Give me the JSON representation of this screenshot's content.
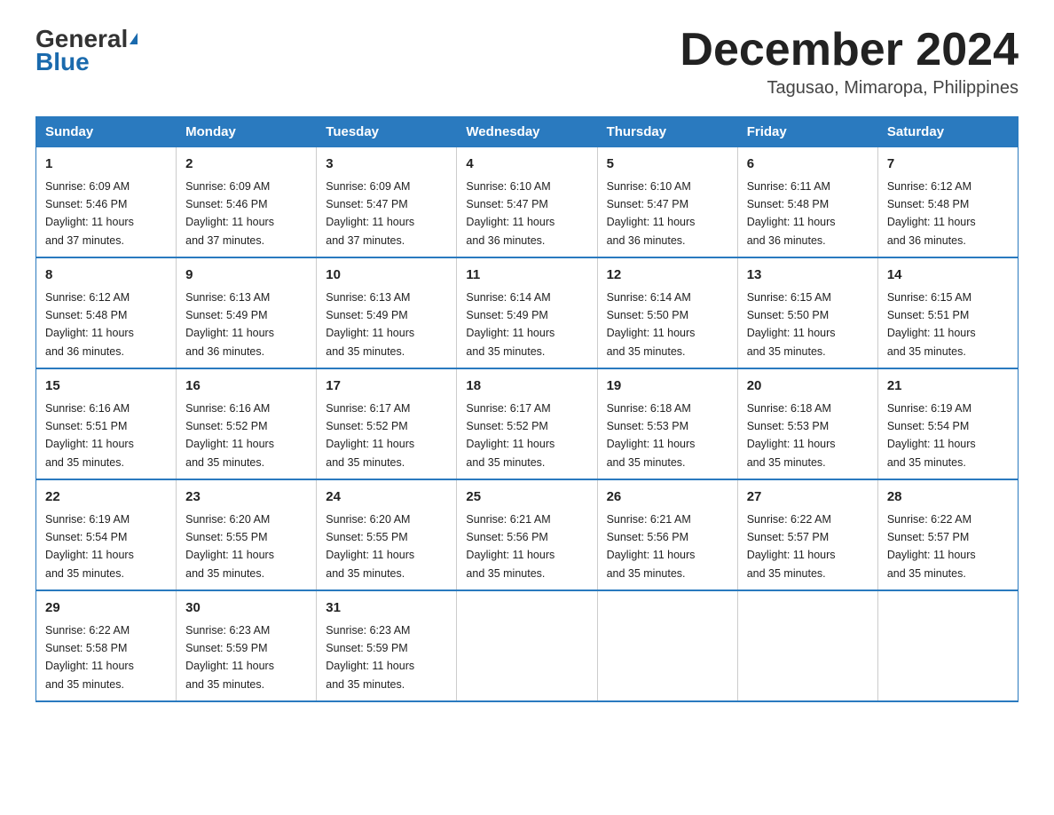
{
  "header": {
    "logo_general": "General",
    "logo_blue": "Blue",
    "month_title": "December 2024",
    "location": "Tagusao, Mimaropa, Philippines"
  },
  "days_of_week": [
    "Sunday",
    "Monday",
    "Tuesday",
    "Wednesday",
    "Thursday",
    "Friday",
    "Saturday"
  ],
  "weeks": [
    [
      {
        "day": "1",
        "sunrise": "6:09 AM",
        "sunset": "5:46 PM",
        "daylight": "11 hours and 37 minutes."
      },
      {
        "day": "2",
        "sunrise": "6:09 AM",
        "sunset": "5:46 PM",
        "daylight": "11 hours and 37 minutes."
      },
      {
        "day": "3",
        "sunrise": "6:09 AM",
        "sunset": "5:47 PM",
        "daylight": "11 hours and 37 minutes."
      },
      {
        "day": "4",
        "sunrise": "6:10 AM",
        "sunset": "5:47 PM",
        "daylight": "11 hours and 36 minutes."
      },
      {
        "day": "5",
        "sunrise": "6:10 AM",
        "sunset": "5:47 PM",
        "daylight": "11 hours and 36 minutes."
      },
      {
        "day": "6",
        "sunrise": "6:11 AM",
        "sunset": "5:48 PM",
        "daylight": "11 hours and 36 minutes."
      },
      {
        "day": "7",
        "sunrise": "6:12 AM",
        "sunset": "5:48 PM",
        "daylight": "11 hours and 36 minutes."
      }
    ],
    [
      {
        "day": "8",
        "sunrise": "6:12 AM",
        "sunset": "5:48 PM",
        "daylight": "11 hours and 36 minutes."
      },
      {
        "day": "9",
        "sunrise": "6:13 AM",
        "sunset": "5:49 PM",
        "daylight": "11 hours and 36 minutes."
      },
      {
        "day": "10",
        "sunrise": "6:13 AM",
        "sunset": "5:49 PM",
        "daylight": "11 hours and 35 minutes."
      },
      {
        "day": "11",
        "sunrise": "6:14 AM",
        "sunset": "5:49 PM",
        "daylight": "11 hours and 35 minutes."
      },
      {
        "day": "12",
        "sunrise": "6:14 AM",
        "sunset": "5:50 PM",
        "daylight": "11 hours and 35 minutes."
      },
      {
        "day": "13",
        "sunrise": "6:15 AM",
        "sunset": "5:50 PM",
        "daylight": "11 hours and 35 minutes."
      },
      {
        "day": "14",
        "sunrise": "6:15 AM",
        "sunset": "5:51 PM",
        "daylight": "11 hours and 35 minutes."
      }
    ],
    [
      {
        "day": "15",
        "sunrise": "6:16 AM",
        "sunset": "5:51 PM",
        "daylight": "11 hours and 35 minutes."
      },
      {
        "day": "16",
        "sunrise": "6:16 AM",
        "sunset": "5:52 PM",
        "daylight": "11 hours and 35 minutes."
      },
      {
        "day": "17",
        "sunrise": "6:17 AM",
        "sunset": "5:52 PM",
        "daylight": "11 hours and 35 minutes."
      },
      {
        "day": "18",
        "sunrise": "6:17 AM",
        "sunset": "5:52 PM",
        "daylight": "11 hours and 35 minutes."
      },
      {
        "day": "19",
        "sunrise": "6:18 AM",
        "sunset": "5:53 PM",
        "daylight": "11 hours and 35 minutes."
      },
      {
        "day": "20",
        "sunrise": "6:18 AM",
        "sunset": "5:53 PM",
        "daylight": "11 hours and 35 minutes."
      },
      {
        "day": "21",
        "sunrise": "6:19 AM",
        "sunset": "5:54 PM",
        "daylight": "11 hours and 35 minutes."
      }
    ],
    [
      {
        "day": "22",
        "sunrise": "6:19 AM",
        "sunset": "5:54 PM",
        "daylight": "11 hours and 35 minutes."
      },
      {
        "day": "23",
        "sunrise": "6:20 AM",
        "sunset": "5:55 PM",
        "daylight": "11 hours and 35 minutes."
      },
      {
        "day": "24",
        "sunrise": "6:20 AM",
        "sunset": "5:55 PM",
        "daylight": "11 hours and 35 minutes."
      },
      {
        "day": "25",
        "sunrise": "6:21 AM",
        "sunset": "5:56 PM",
        "daylight": "11 hours and 35 minutes."
      },
      {
        "day": "26",
        "sunrise": "6:21 AM",
        "sunset": "5:56 PM",
        "daylight": "11 hours and 35 minutes."
      },
      {
        "day": "27",
        "sunrise": "6:22 AM",
        "sunset": "5:57 PM",
        "daylight": "11 hours and 35 minutes."
      },
      {
        "day": "28",
        "sunrise": "6:22 AM",
        "sunset": "5:57 PM",
        "daylight": "11 hours and 35 minutes."
      }
    ],
    [
      {
        "day": "29",
        "sunrise": "6:22 AM",
        "sunset": "5:58 PM",
        "daylight": "11 hours and 35 minutes."
      },
      {
        "day": "30",
        "sunrise": "6:23 AM",
        "sunset": "5:59 PM",
        "daylight": "11 hours and 35 minutes."
      },
      {
        "day": "31",
        "sunrise": "6:23 AM",
        "sunset": "5:59 PM",
        "daylight": "11 hours and 35 minutes."
      },
      null,
      null,
      null,
      null
    ]
  ],
  "labels": {
    "sunrise": "Sunrise:",
    "sunset": "Sunset:",
    "daylight": "Daylight:"
  }
}
